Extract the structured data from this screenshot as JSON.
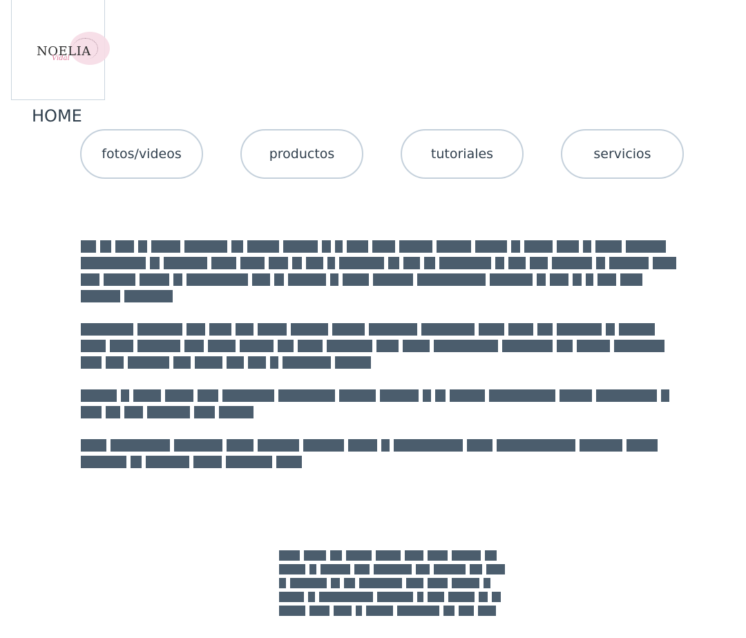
{
  "logo": {
    "wordmark": "NOELIA",
    "script": "Vidal"
  },
  "home": {
    "title": "HOME"
  },
  "nav": {
    "buttons": [
      {
        "label": "fotos/videos"
      },
      {
        "label": "productos"
      },
      {
        "label": "tutoriales"
      },
      {
        "label": "servicios"
      }
    ]
  },
  "colors": {
    "redacted_text": "#4b5d6d",
    "pill_border": "#c4d0db",
    "logo_pink": "#f6dbe6",
    "heading": "#2f3e4c"
  }
}
